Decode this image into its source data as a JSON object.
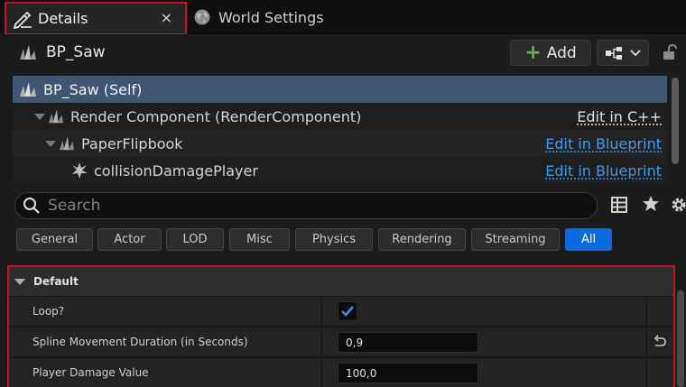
{
  "tabs": {
    "details_label": "Details",
    "details_close": "×",
    "world_label": "World Settings"
  },
  "header": {
    "blueprint_name": "BP_Saw",
    "add_label": "Add"
  },
  "tree": {
    "rows": [
      {
        "name": "BP_Saw (Self)",
        "link": ""
      },
      {
        "name": "Render Component (RenderComponent)",
        "link": "Edit in C++"
      },
      {
        "name": "PaperFlipbook",
        "link": "Edit in Blueprint"
      },
      {
        "name": "collisionDamagePlayer",
        "link": "Edit in Blueprint"
      }
    ]
  },
  "search": {
    "placeholder": "Search"
  },
  "filters": [
    "General",
    "Actor",
    "LOD",
    "Misc",
    "Physics",
    "Rendering",
    "Streaming",
    "All"
  ],
  "active_filter": "All",
  "section": {
    "title": "Default",
    "properties": [
      {
        "label": "Loop?",
        "value": "checked"
      },
      {
        "label": "Spline Movement Duration (in Seconds)",
        "value": "0,9"
      },
      {
        "label": "Player Damage Value",
        "value": "100,0"
      }
    ]
  },
  "colors": {
    "accent_blue": "#0a6ae0",
    "selection": "#3e5674",
    "highlight_red": "#c8101e",
    "add_green": "#5fb944",
    "link_blue": "#3d9ae8",
    "cpp_link": "#e0e0e0"
  },
  "icons": [
    "pencil-icon",
    "close-icon",
    "globe-icon",
    "blueprint-icon",
    "plus-icon",
    "hierarchy-icon",
    "chevron-down-icon",
    "lock-icon",
    "search-icon",
    "table-icon",
    "star-icon",
    "gear-icon",
    "reset-icon",
    "checkmark-icon"
  ]
}
